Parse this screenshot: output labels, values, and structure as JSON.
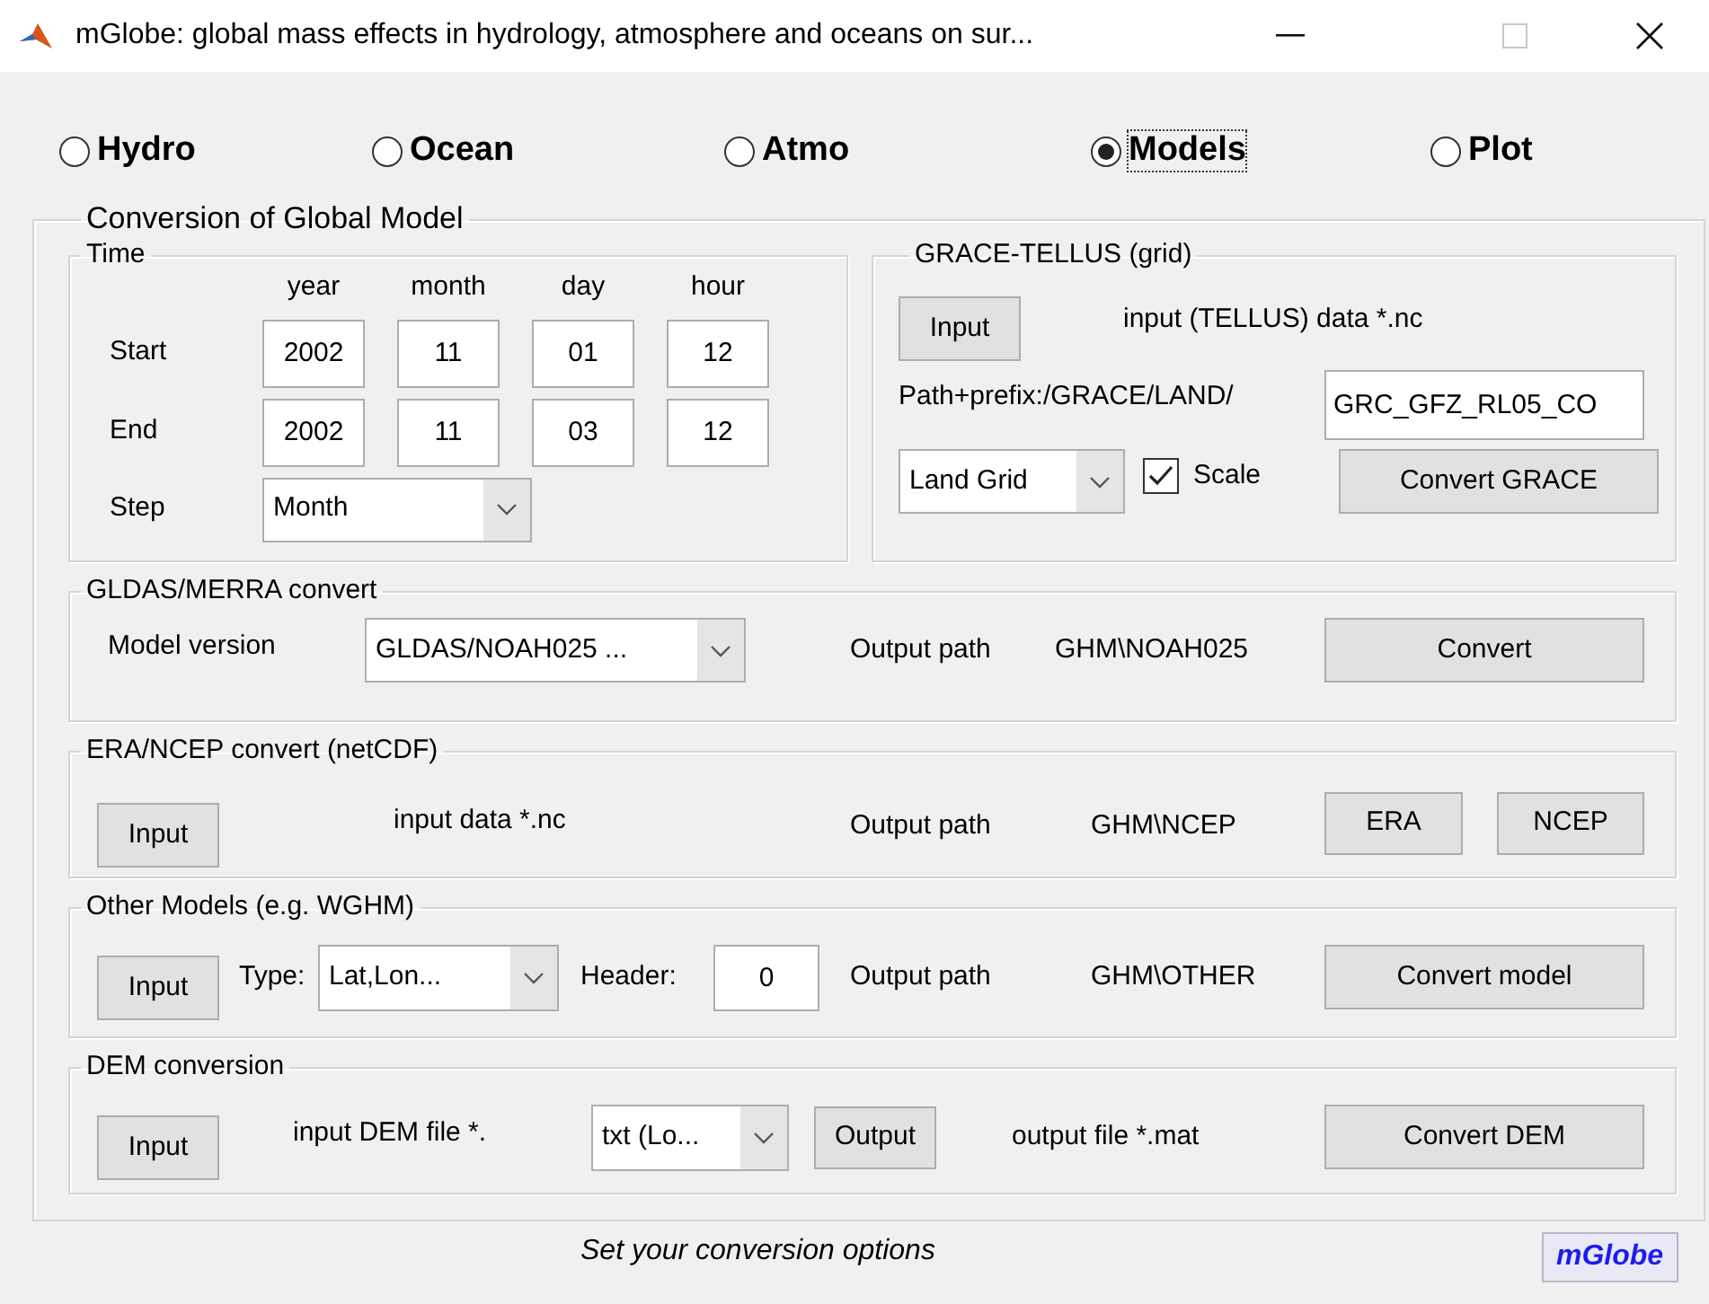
{
  "window": {
    "title": "mGlobe: global mass effects in hydrology, atmosphere and oceans on sur..."
  },
  "modes": [
    {
      "label": "Hydro",
      "selected": false,
      "focused": false
    },
    {
      "label": "Ocean",
      "selected": false,
      "focused": false
    },
    {
      "label": "Atmo",
      "selected": false,
      "focused": false
    },
    {
      "label": "Models",
      "selected": true,
      "focused": true
    },
    {
      "label": "Plot",
      "selected": false,
      "focused": false
    }
  ],
  "panel": {
    "title": "Conversion of Global Model"
  },
  "time": {
    "title": "Time",
    "columns": [
      "year",
      "month",
      "day",
      "hour"
    ],
    "rows": [
      {
        "label": "Start",
        "values": [
          "2002",
          "11",
          "01",
          "12"
        ]
      },
      {
        "label": "End",
        "values": [
          "2002",
          "11",
          "03",
          "12"
        ]
      }
    ],
    "step": {
      "label": "Step",
      "value": "Month"
    }
  },
  "grace": {
    "title": "GRACE-TELLUS (grid)",
    "input_button": "Input",
    "input_note": "input (TELLUS) data *.nc",
    "path_label": "Path+prefix:/GRACE/LAND/",
    "path_value": "GRC_GFZ_RL05_CO",
    "grid_value": "Land Grid",
    "scale": {
      "label": "Scale",
      "checked": true
    },
    "convert_button": "Convert GRACE"
  },
  "gldas": {
    "title": "GLDAS/MERRA convert",
    "model_label": "Model version",
    "model_value": "GLDAS/NOAH025  ...",
    "output_label": "Output path",
    "output_value": "GHM\\NOAH025",
    "convert_button": "Convert"
  },
  "era": {
    "title": "ERA/NCEP convert (netCDF)",
    "input_button": "Input",
    "input_note": "input data *.nc",
    "output_label": "Output path",
    "output_value": "GHM\\NCEP",
    "buttons": [
      "ERA",
      "NCEP"
    ]
  },
  "other": {
    "title": "Other Models (e.g. WGHM)",
    "input_button": "Input",
    "type_label": "Type:",
    "type_value": "Lat,Lon...",
    "header_label": "Header:",
    "header_value": "0",
    "output_label": "Output path",
    "output_value": "GHM\\OTHER",
    "convert_button": "Convert model"
  },
  "dem": {
    "title": "DEM conversion",
    "input_button": "Input",
    "input_note": "input DEM file *.",
    "format_value": "txt (Lo...",
    "output_button": "Output",
    "output_note": "output file *.mat",
    "convert_button": "Convert DEM"
  },
  "status": "Set your conversion options",
  "brand": "mGlobe"
}
